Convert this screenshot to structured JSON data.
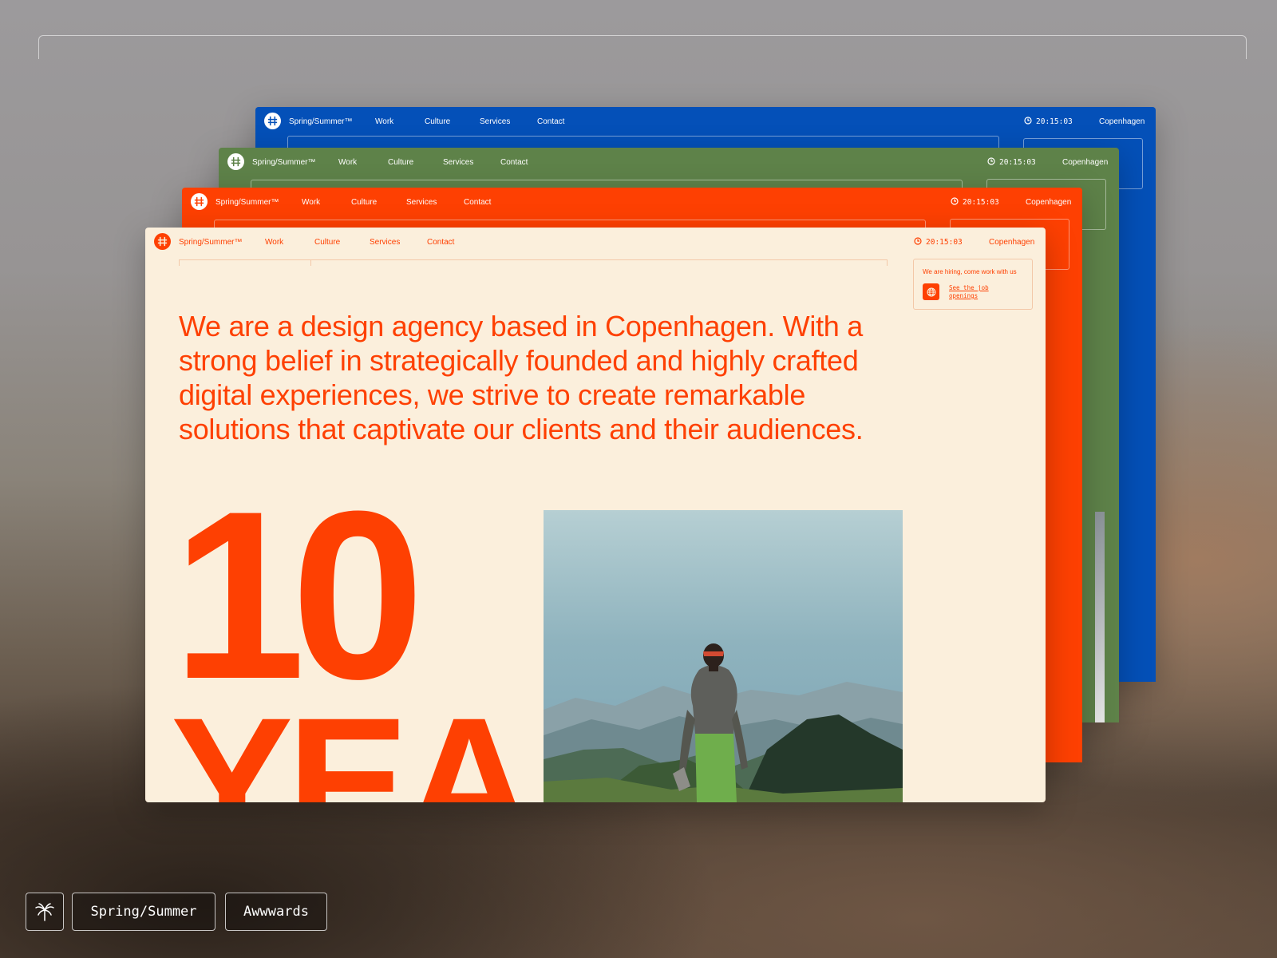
{
  "site": {
    "brand": "Spring/Summer™",
    "nav": [
      "Work",
      "Culture",
      "Services",
      "Contact"
    ],
    "time": "20:15:03",
    "city": "Copenhagen"
  },
  "hiring": {
    "text": "We are hiring, come work with us",
    "link": "See the job openings"
  },
  "hero": {
    "statement": "We are a design agency based in Copenhagen. With a strong belief in strategically founded and highly crafted digital experiences, we strive to create remarkable solutions that captivate our clients and their audiences.",
    "number": "10",
    "word": "YEA"
  },
  "footer": {
    "icon": "palm-tree-icon",
    "brand_chip": "Spring/Summer",
    "award_chip": "Awwwards"
  },
  "colors": {
    "blue": "#0450b8",
    "green": "#5e8249",
    "orange": "#fe4002",
    "cream": "#fbefdc"
  }
}
